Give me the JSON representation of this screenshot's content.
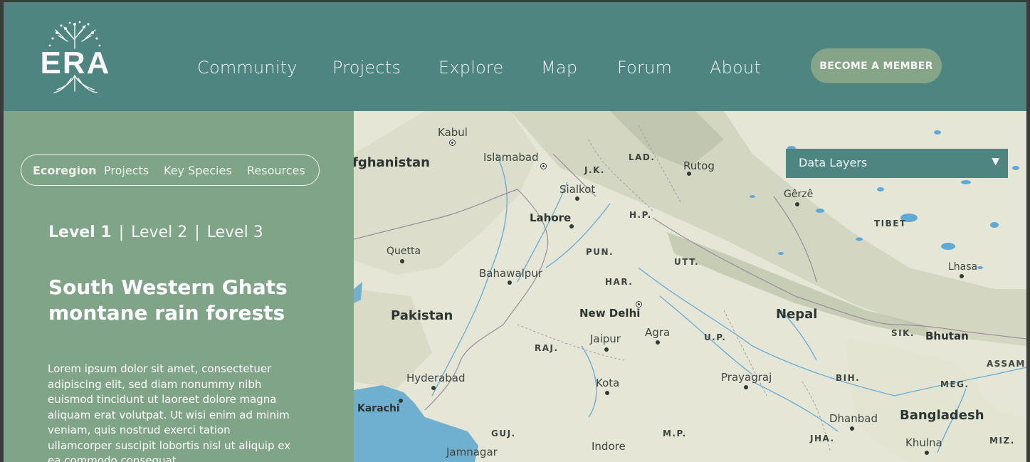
{
  "header": {
    "logo_text": "ERA",
    "nav": [
      "Community",
      "Projects",
      "Explore",
      "Map",
      "Forum",
      "About"
    ],
    "cta_label": "BECOME A MEMBER"
  },
  "sidebar": {
    "tabs": [
      "Ecoregion",
      "Projects",
      "Key Species",
      "Resources"
    ],
    "levels": [
      "Level 1",
      "Level 2",
      "Level 3"
    ],
    "level_separator": "|",
    "title": "South Western Ghats montane rain forests",
    "description": "Lorem ipsum dolor sit amet, consectetuer adipiscing elit, sed diam nonummy nibh euismod tincidunt ut laoreet dolore magna aliquam erat volutpat. Ut wisi enim ad minim veniam, quis nostrud exerci tation ullamcorper suscipit lobortis nisl ut aliquip ex ea commodo consequat."
  },
  "map": {
    "layers_label": "Data Layers",
    "layers_caret": "▼",
    "labels": {
      "afghanistan": "fghanistan",
      "kabul": "Kabul",
      "islamabad": "Islamabad",
      "jk": "J.K.",
      "lad": "LAD.",
      "rutog": "Rutog",
      "sialkot": "Sialkot",
      "gerze": "Gêrzê",
      "lahore": "Lahore",
      "hp": "H.P.",
      "tibet": "TIBET",
      "quetta": "Quetta",
      "pun": "PUN.",
      "utt": "UTT.",
      "lhasa": "Lhasa",
      "bahawalpur": "Bahawalpur",
      "har": "HAR.",
      "pakistan": "Pakistan",
      "new_delhi": "New Delhi",
      "nepal": "Nepal",
      "agra": "Agra",
      "sik": "SIK.",
      "bhutan": "Bhutan",
      "jaipur": "Jaipur",
      "raj": "RAJ.",
      "up": "U.P.",
      "assam": "ASSAM",
      "prayagraj": "Prayagraj",
      "hyderabad": "Hyderabad",
      "bih": "BIH.",
      "meg": "MEG.",
      "kota": "Kota",
      "karachi": "Karachi",
      "dhanbad": "Dhanbad",
      "bangladesh": "Bangladesh",
      "guj": "GUJ.",
      "mp": "M.P.",
      "jha": "JHA.",
      "khulna": "Khulna",
      "miz": "MIZ.",
      "jamnagar": "Jamnagar",
      "indore": "Indore"
    }
  }
}
